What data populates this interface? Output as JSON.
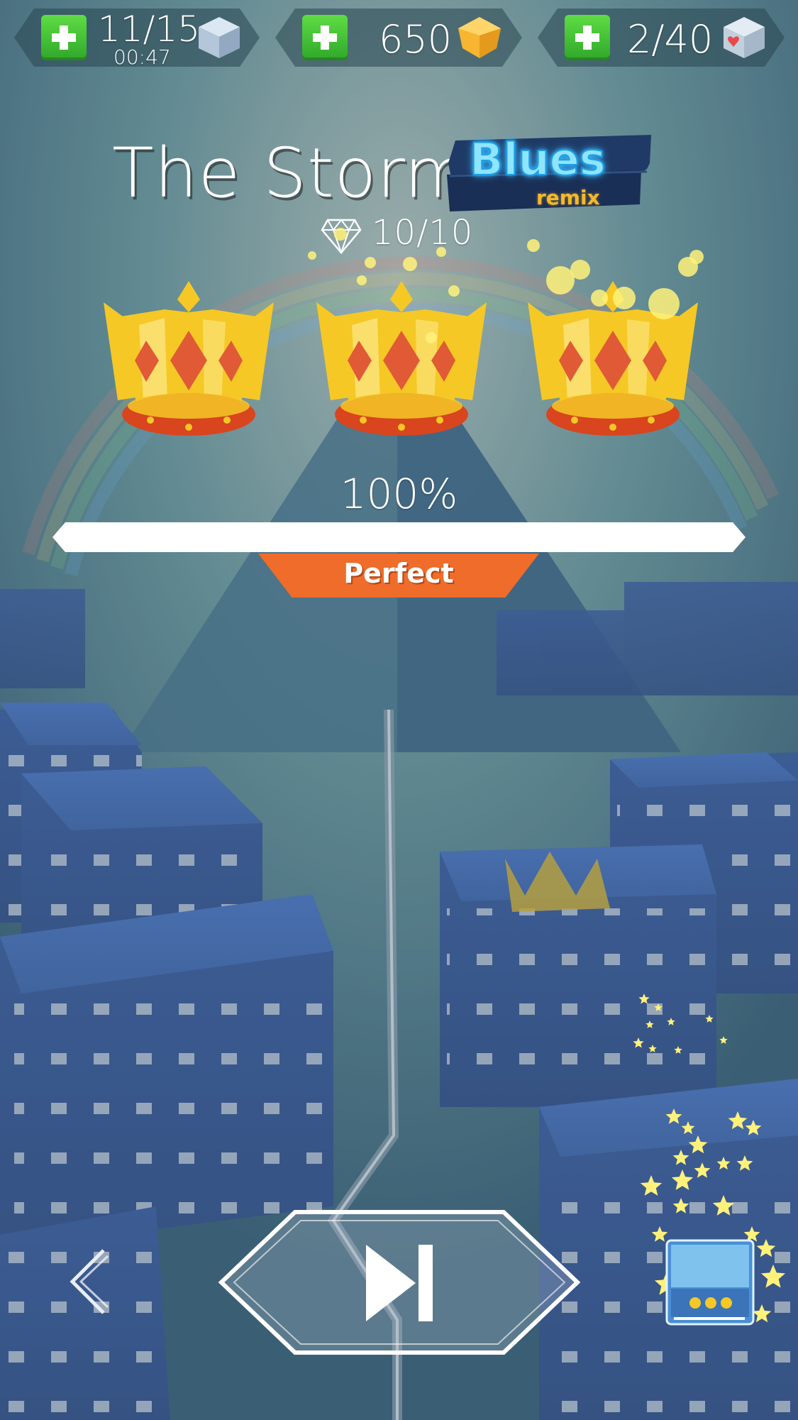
{
  "hud": {
    "energy": {
      "count": "11/15",
      "timer": "00:47",
      "icon": "blue-cube-icon"
    },
    "gems": {
      "count": "650",
      "icon": "gold-gem-icon"
    },
    "hearts": {
      "count": "2/40",
      "icon": "heart-cube-icon"
    }
  },
  "song": {
    "title": "The Storm",
    "remix_top": "Blues",
    "remix_bottom": "remix",
    "diamonds": "10/10"
  },
  "result": {
    "crowns_earned": 3,
    "crowns_total": 3,
    "percent_text": "100%",
    "progress_fraction": 1.0,
    "rating": "Perfect"
  },
  "controls": {
    "back_icon": "chevron-left-icon",
    "next_icon": "skip-next-icon",
    "thumbnail_icon": "gift-thumbnail-icon"
  },
  "colors": {
    "accent_orange": "#ef6c2a",
    "plus_green": "#3cba2f",
    "crown_gold": "#f5c826",
    "crown_band": "#d8451e",
    "remix_blue": "#5fd0ff",
    "remix_gold": "#f5b82a"
  }
}
